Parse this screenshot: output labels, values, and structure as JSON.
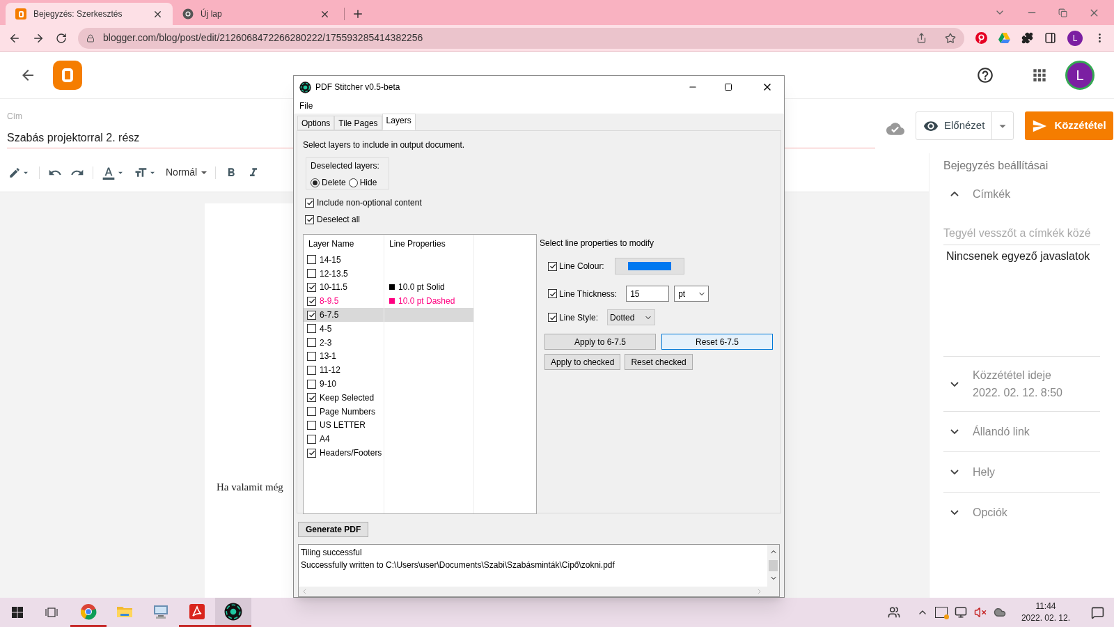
{
  "browser": {
    "tabs": [
      {
        "title": "Bejegyzés: Szerkesztés",
        "kind": "blogger",
        "selected": true
      },
      {
        "title": "Új lap",
        "kind": "chrome",
        "selected": false
      }
    ],
    "url": "blogger.com/blog/post/edit/2126068472266280222/175593285414382256",
    "profile_initial": "L"
  },
  "blogger": {
    "avatar_initial": "L",
    "title_label": "Cím",
    "title_value": "Szabás projektorral 2. rész",
    "paragraph_style": "Normál",
    "preview_button": "Előnézet",
    "publish_button": "Közzététel",
    "body_text": "Ha valamit még",
    "settings": {
      "heading": "Bejegyzés beállításai",
      "sections": [
        {
          "title": "Címkék",
          "expanded": true,
          "placeholder": "Tegyél vesszőt a címkék közé",
          "note": "Nincsenek egyező javaslatok"
        },
        {
          "title": "Közzététel ideje",
          "subtitle": "2022. 02. 12. 8:50",
          "expanded": false
        },
        {
          "title": "Állandó link",
          "expanded": false
        },
        {
          "title": "Hely",
          "expanded": false
        },
        {
          "title": "Opciók",
          "expanded": false
        }
      ]
    }
  },
  "dialog": {
    "title": "PDF Stitcher v0.5-beta",
    "menu": [
      "File"
    ],
    "tabs": [
      {
        "label": "Options",
        "selected": false
      },
      {
        "label": "Tile Pages",
        "selected": false
      },
      {
        "label": "Layers",
        "selected": true
      }
    ],
    "instruction": "Select layers to include in output document.",
    "deselected_group": {
      "label": "Deselected layers:",
      "options": [
        {
          "label": "Delete",
          "selected": true
        },
        {
          "label": "Hide",
          "selected": false
        }
      ]
    },
    "options": [
      {
        "label": "Include non-optional content",
        "checked": true
      },
      {
        "label": "Deselect all",
        "checked": true
      }
    ],
    "layers": {
      "columns": [
        "Layer Name",
        "Line Properties"
      ],
      "rows": [
        {
          "name": "14-15",
          "checked": false,
          "selected": false
        },
        {
          "name": "12-13.5",
          "checked": false,
          "selected": false
        },
        {
          "name": "10-11.5",
          "checked": true,
          "selected": false,
          "line_properties": "10.0 pt Solid",
          "color": "#000000"
        },
        {
          "name": "8-9.5",
          "checked": true,
          "selected": false,
          "line_properties": "10.0 pt Dashed",
          "color": "#ff0080"
        },
        {
          "name": "6-7.5",
          "checked": true,
          "selected": true
        },
        {
          "name": "4-5",
          "checked": false,
          "selected": false
        },
        {
          "name": "2-3",
          "checked": false,
          "selected": false
        },
        {
          "name": "13-1",
          "checked": false,
          "selected": false
        },
        {
          "name": "11-12",
          "checked": false,
          "selected": false
        },
        {
          "name": "9-10",
          "checked": false,
          "selected": false
        },
        {
          "name": "Keep Selected",
          "checked": true,
          "selected": false
        },
        {
          "name": "Page Numbers",
          "checked": false,
          "selected": false
        },
        {
          "name": "US LETTER",
          "checked": false,
          "selected": false
        },
        {
          "name": "A4",
          "checked": false,
          "selected": false
        },
        {
          "name": "Headers/Footers",
          "checked": true,
          "selected": false
        }
      ]
    },
    "properties": {
      "heading": "Select line properties to modify",
      "colour": {
        "label": "Line Colour:",
        "checked": true,
        "color": "#0078f0"
      },
      "thickness": {
        "label": "Line Thickness:",
        "checked": true,
        "value": "15",
        "unit": "pt"
      },
      "style": {
        "label": "Line Style:",
        "checked": true,
        "value": "Dotted"
      },
      "buttons": [
        {
          "label": "Apply to 6-7.5",
          "focused": false
        },
        {
          "label": "Reset 6-7.5",
          "focused": true
        },
        {
          "label": "Apply to checked",
          "focused": false
        },
        {
          "label": "Reset checked",
          "focused": false
        }
      ]
    },
    "generate_button": "Generate PDF",
    "log": [
      "Tiling successful",
      "Successfully written to C:\\Users\\user\\Documents\\Szabi\\Szabásminták\\Cipő\\zokni.pdf"
    ]
  },
  "taskbar": {
    "apps": [
      {
        "kind": "chrome",
        "running": true,
        "selected": false
      },
      {
        "kind": "explorer",
        "running": false,
        "selected": false
      },
      {
        "kind": "monitor",
        "running": false,
        "selected": false
      },
      {
        "kind": "acrobat",
        "running": true,
        "selected": false
      },
      {
        "kind": "stitcher",
        "running": true,
        "selected": true
      }
    ],
    "time": "11:44",
    "date": "2022. 02. 12."
  }
}
